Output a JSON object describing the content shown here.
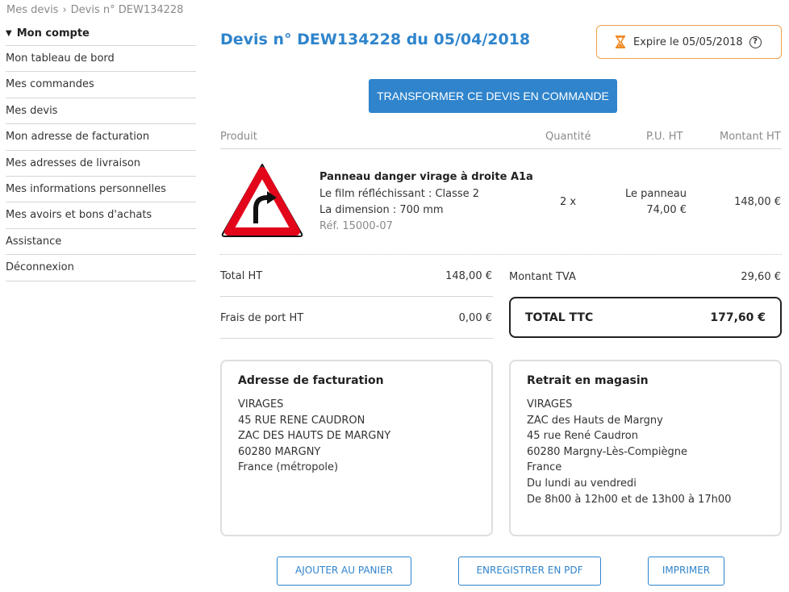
{
  "breadcrumb": {
    "parent": "Mes devis",
    "separator": "›",
    "current": "Devis n° DEW134228"
  },
  "sidebar": {
    "heading": "Mon compte",
    "items": [
      "Mon tableau de bord",
      "Mes commandes",
      "Mes devis",
      "Mon adresse de facturation",
      "Mes adresses de livraison",
      "Mes informations personnelles",
      "Mes avoirs et bons d'achats",
      "Assistance",
      "Déconnexion"
    ]
  },
  "quote": {
    "title": "Devis n° DEW134228 du 05/04/2018",
    "expire_label": "Expire le 05/05/2018",
    "help_glyph": "?"
  },
  "actions": {
    "convert_label": "TRANSFORMER CE DEVIS EN COMMANDE"
  },
  "table": {
    "headers": {
      "product": "Produit",
      "quantity": "Quantité",
      "unit_price": "P.U. HT",
      "amount": "Montant HT"
    },
    "row": {
      "name": "Panneau danger virage à droite A1a",
      "film": "Le film réfléchissant : Classe 2",
      "dimension": "La dimension : 700 mm",
      "ref": "Réf. 15000-07",
      "quantity": "2 x",
      "unit_label": "Le panneau",
      "unit_price": "74,00 €",
      "amount": "148,00 €",
      "image_icon": "warning-curve-right-sign"
    }
  },
  "totals": {
    "total_ht_label": "Total HT",
    "total_ht": "148,00 €",
    "shipping_label": "Frais de port HT",
    "shipping": "0,00 €",
    "tva_label": "Montant TVA",
    "tva": "29,60 €",
    "ttc_label": "TOTAL TTC",
    "ttc": "177,60 €"
  },
  "billing": {
    "title": "Adresse de facturation",
    "lines": [
      "VIRAGES",
      "45 RUE RENE CAUDRON",
      "ZAC DES HAUTS DE MARGNY",
      "60280 MARGNY",
      "France (métropole)"
    ]
  },
  "pickup": {
    "title": "Retrait en magasin",
    "lines": [
      "VIRAGES",
      "ZAC des Hauts de Margny",
      "45 rue René Caudron",
      "60280 Margny-Lès-Compiègne",
      "France",
      "Du lundi au vendredi",
      "De 8h00 à 12h00 et de 13h00 à 17h00"
    ]
  },
  "bottom_buttons": {
    "add_cart": "AJOUTER AU PANIER",
    "save_pdf": "ENREGISTRER EN PDF",
    "print": "IMPRIMER"
  },
  "colors": {
    "accent": "#2f84cc",
    "expire_border": "#f0a04b",
    "hourglass": "#f08a24",
    "sign_red": "#e3061b"
  }
}
